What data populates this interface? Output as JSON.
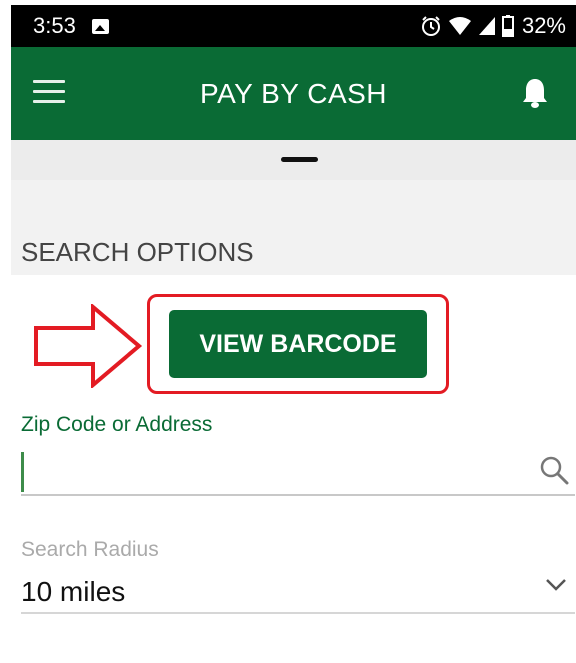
{
  "status_bar": {
    "time": "3:53",
    "battery": "32%",
    "icons": [
      "image-icon",
      "alarm-icon",
      "wifi-icon",
      "signal-icon",
      "battery-icon"
    ]
  },
  "app_bar": {
    "title": "PAY BY CASH",
    "menu_icon": "hamburger-menu-icon",
    "notification_icon": "bell-icon",
    "background": "#0a6b35"
  },
  "section": {
    "title": "SEARCH OPTIONS"
  },
  "barcode_button": {
    "label": "VIEW BARCODE",
    "highlight_color": "#e31b23"
  },
  "zip_field": {
    "label": "Zip Code or Address",
    "value": "",
    "icon": "search-icon"
  },
  "radius_field": {
    "label": "Search Radius",
    "value": "10 miles",
    "icon": "chevron-down-icon"
  }
}
